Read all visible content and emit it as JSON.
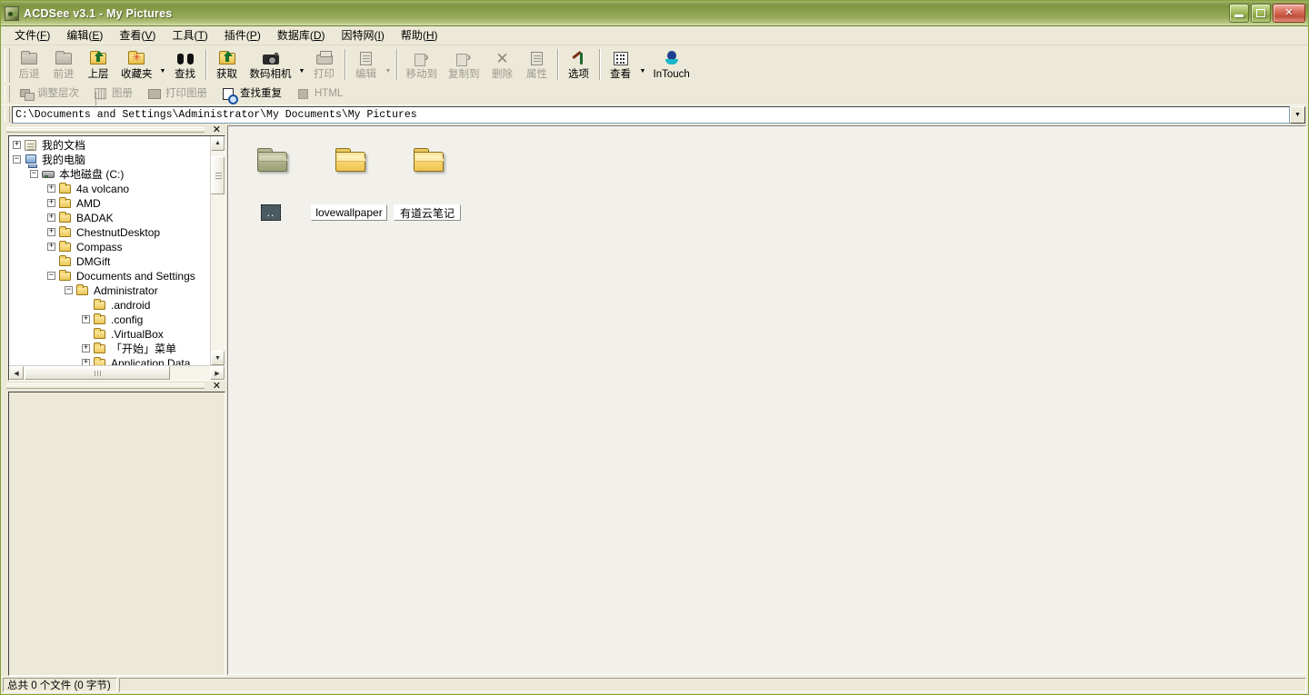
{
  "window": {
    "title": "ACDSee v3.1 - My Pictures",
    "icon": "acdsee-app-icon",
    "buttons": {
      "minimize": "minimize-button",
      "maximize": "maximize-button",
      "close_glyph": "✕"
    }
  },
  "menubar": {
    "items": [
      {
        "label": "文件",
        "accel": "F"
      },
      {
        "label": "编辑",
        "accel": "E"
      },
      {
        "label": "查看",
        "accel": "V"
      },
      {
        "label": "工具",
        "accel": "T"
      },
      {
        "label": "插件",
        "accel": "P"
      },
      {
        "label": "数据库",
        "accel": "D"
      },
      {
        "label": "因特网",
        "accel": "I"
      },
      {
        "label": "帮助",
        "accel": "H"
      }
    ]
  },
  "toolbar_main": {
    "buttons": [
      {
        "label": "后退",
        "icon": "back-folder-icon",
        "enabled": false
      },
      {
        "label": "前进",
        "icon": "forward-folder-icon",
        "enabled": false
      },
      {
        "label": "上层",
        "icon": "up-folder-icon",
        "enabled": true
      },
      {
        "label": "收藏夹",
        "icon": "favorites-folder-icon",
        "enabled": true
      },
      {
        "label": "查找",
        "icon": "binoculars-icon",
        "enabled": true
      },
      {
        "label": "获取",
        "icon": "acquire-icon",
        "enabled": true
      },
      {
        "label": "数码相机",
        "icon": "digital-camera-icon",
        "enabled": true
      },
      {
        "label": "打印",
        "icon": "printer-icon",
        "enabled": false
      },
      {
        "label": "编辑",
        "icon": "edit-image-icon",
        "enabled": false
      },
      {
        "label": "移动到",
        "icon": "move-to-icon",
        "enabled": false
      },
      {
        "label": "复制到",
        "icon": "copy-to-icon",
        "enabled": false
      },
      {
        "label": "删除",
        "icon": "delete-x-icon",
        "enabled": false
      },
      {
        "label": "属性",
        "icon": "properties-icon",
        "enabled": false
      },
      {
        "label": "选项",
        "icon": "options-hammer-icon",
        "enabled": true
      },
      {
        "label": "查看",
        "icon": "view-list-icon",
        "enabled": true
      },
      {
        "label": "InTouch",
        "icon": "intouch-icon",
        "enabled": true
      }
    ]
  },
  "toolbar_secondary": {
    "buttons": [
      {
        "label": "调整层次",
        "icon": "adjust-levels-icon",
        "enabled": false
      },
      {
        "label": "图册",
        "icon": "album-grid-icon",
        "enabled": false
      },
      {
        "label": "打印图册",
        "icon": "print-album-icon",
        "enabled": false
      },
      {
        "label": "查找重复",
        "icon": "find-duplicates-icon",
        "enabled": true
      },
      {
        "label": "HTML",
        "icon": "html-icon",
        "enabled": false
      }
    ]
  },
  "addressbar": {
    "value": "C:\\Documents and Settings\\Administrator\\My Documents\\My Pictures",
    "dropdown_glyph": "▼"
  },
  "tree_pane": {
    "close_glyph": "✕",
    "nodes": [
      {
        "label": "我的文档",
        "depth": 0,
        "expander": "+",
        "icon": "my-documents-icon"
      },
      {
        "label": "我的电脑",
        "depth": 0,
        "expander": "−",
        "icon": "my-computer-icon"
      },
      {
        "label": "本地磁盘 (C:)",
        "depth": 1,
        "expander": "−",
        "icon": "hard-drive-icon"
      },
      {
        "label": "4a volcano",
        "depth": 2,
        "expander": "+",
        "icon": "folder-icon"
      },
      {
        "label": "AMD",
        "depth": 2,
        "expander": "+",
        "icon": "folder-icon"
      },
      {
        "label": "BADAK",
        "depth": 2,
        "expander": "+",
        "icon": "folder-icon"
      },
      {
        "label": "ChestnutDesktop",
        "depth": 2,
        "expander": "+",
        "icon": "folder-icon"
      },
      {
        "label": "Compass",
        "depth": 2,
        "expander": "+",
        "icon": "folder-icon"
      },
      {
        "label": "DMGift",
        "depth": 2,
        "expander": "",
        "icon": "folder-icon"
      },
      {
        "label": "Documents and Settings",
        "depth": 2,
        "expander": "−",
        "icon": "folder-icon"
      },
      {
        "label": "Administrator",
        "depth": 3,
        "expander": "−",
        "icon": "folder-icon"
      },
      {
        "label": ".android",
        "depth": 4,
        "expander": "",
        "icon": "folder-icon"
      },
      {
        "label": ".config",
        "depth": 4,
        "expander": "+",
        "icon": "folder-icon"
      },
      {
        "label": ".VirtualBox",
        "depth": 4,
        "expander": "",
        "icon": "folder-icon"
      },
      {
        "label": "「开始」菜单",
        "depth": 4,
        "expander": "+",
        "icon": "folder-icon"
      },
      {
        "label": "Application Data",
        "depth": 4,
        "expander": "+",
        "icon": "folder-icon"
      }
    ],
    "scroll": {
      "up_glyph": "▲",
      "down_glyph": "▼",
      "left_glyph": "◀",
      "right_glyph": "▶"
    }
  },
  "preview_pane": {
    "close_glyph": "✕"
  },
  "content": {
    "items": [
      {
        "label": "..",
        "icon": "parent-folder-icon",
        "selected": true
      },
      {
        "label": "lovewallpaper",
        "icon": "folder-icon",
        "selected": false
      },
      {
        "label": "有道云笔记",
        "icon": "folder-icon",
        "selected": false
      }
    ]
  },
  "statusbar": {
    "left": "总共 0 个文件 (0 字节)",
    "right": ""
  },
  "colors": {
    "titlebar_green": "#8ba04e",
    "close_red": "#c0503c",
    "window_face": "#ece9d8",
    "content_bg": "#f1f0eb",
    "selection": "#4a5c62",
    "folder_yellow": "#efc44f"
  }
}
